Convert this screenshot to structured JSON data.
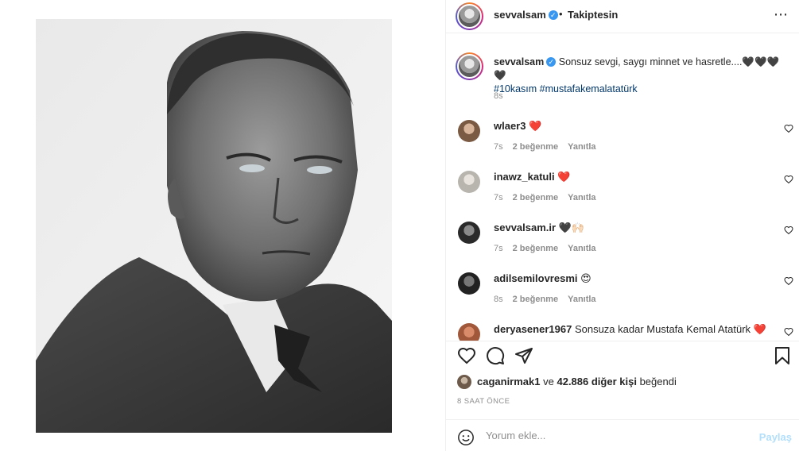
{
  "header": {
    "username": "sevvalsam",
    "dot": "•",
    "follow_label": "Takiptesin",
    "more_icon": "more-horizontal-icon"
  },
  "caption": {
    "username": "sevvalsam",
    "text": "Sonsuz sevgi, saygı minnet ve hasretle....",
    "hashtags": "#10kasım #mustafakemalatatürk",
    "time": "8s"
  },
  "comments": [
    {
      "username": "wlaer3",
      "text": "❤️",
      "time": "7s",
      "likes": "2 beğenme",
      "reply": "Yanıtla",
      "avatar_color": "#7b5a44"
    },
    {
      "username": "inawz_katuli",
      "text": "❤️",
      "time": "7s",
      "likes": "2 beğenme",
      "reply": "Yanıtla",
      "avatar_color": "#b8b4ae"
    },
    {
      "username": "sevvalsam.ir",
      "text": "🖤🙌🏻",
      "time": "7s",
      "likes": "2 beğenme",
      "reply": "Yanıtla",
      "avatar_color": "#3a3a3a"
    },
    {
      "username": "adilsemilovresmi",
      "text": "😍",
      "time": "8s",
      "likes": "2 beğenme",
      "reply": "Yanıtla",
      "avatar_color": "#2e2e2e"
    },
    {
      "username": "deryasener1967",
      "text": "Sonsuza kadar Mustafa Kemal Atatürk ❤️",
      "time": "",
      "likes": "",
      "reply": "",
      "avatar_color": "#a0573a"
    }
  ],
  "actions": {
    "like_icon": "heart-icon",
    "comment_icon": "comment-icon",
    "share_icon": "share-icon",
    "save_icon": "bookmark-icon"
  },
  "likes": {
    "user": "caganirmak1",
    "connector": "ve",
    "count": "42.886 diğer kişi",
    "suffix": "beğendi"
  },
  "time_ago": "8 SAAT ÖNCE",
  "add_comment": {
    "placeholder": "Yorum ekle...",
    "post_label": "Paylaş"
  },
  "colors": {
    "link": "#00376b",
    "verified": "#3897f0",
    "muted": "#8e8e8e",
    "post_disabled": "#b2dffc",
    "heart": "#ed4956"
  }
}
